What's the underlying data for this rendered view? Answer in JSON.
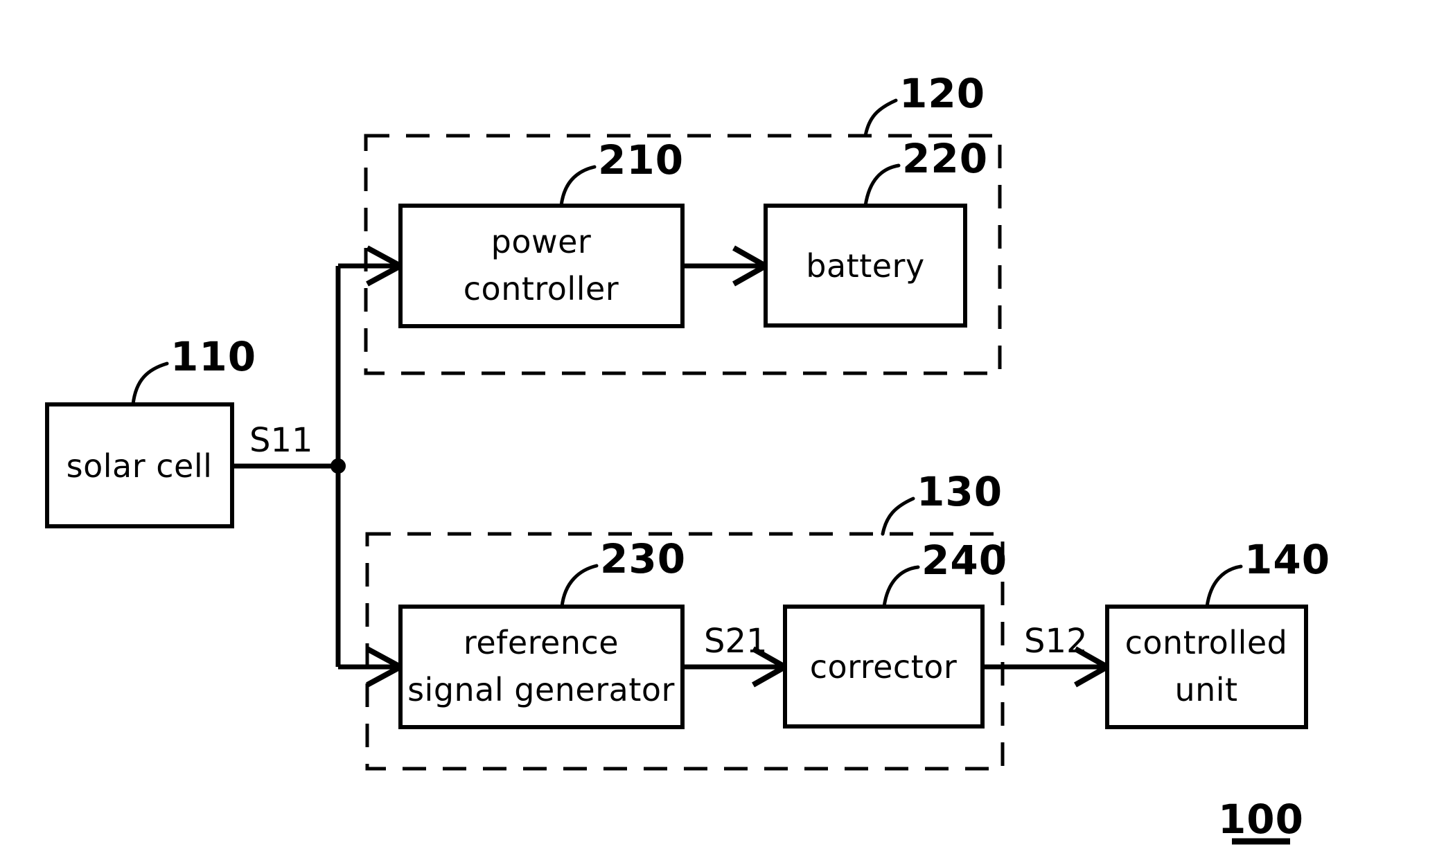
{
  "figure": {
    "number": "100",
    "number_underlined": true
  },
  "blocks": [
    {
      "id": "solar-cell",
      "label": "solar  cell",
      "lines": [
        "solar  cell"
      ],
      "ref": "110",
      "style": "solid"
    },
    {
      "id": "power-controller",
      "label": "power controller",
      "lines": [
        "power",
        "controller"
      ],
      "ref": "210",
      "style": "solid"
    },
    {
      "id": "battery",
      "label": "battery",
      "lines": [
        "battery"
      ],
      "ref": "220",
      "style": "solid"
    },
    {
      "id": "reference-signal-generator",
      "label": "reference signal  generator",
      "lines": [
        "reference",
        "signal  generator"
      ],
      "ref": "230",
      "style": "solid"
    },
    {
      "id": "corrector",
      "label": "corrector",
      "lines": [
        "corrector"
      ],
      "ref": "240",
      "style": "solid"
    },
    {
      "id": "controlled-unit",
      "label": "controlled unit",
      "lines": [
        "controlled",
        "unit"
      ],
      "ref": "140",
      "style": "solid"
    }
  ],
  "groups": [
    {
      "id": "charging-group",
      "ref": "120",
      "style": "dashed"
    },
    {
      "id": "signal-group",
      "ref": "130",
      "style": "dashed"
    }
  ],
  "signals": [
    {
      "id": "s11",
      "label": "S11",
      "from": "solar-cell",
      "to": "power-controller"
    },
    {
      "id": "s21",
      "label": "S21",
      "from": "reference-signal-generator",
      "to": "corrector"
    },
    {
      "id": "s12",
      "label": "S12",
      "from": "corrector",
      "to": "controlled-unit"
    }
  ],
  "colors": {
    "stroke": "#000000",
    "background": "#ffffff"
  }
}
